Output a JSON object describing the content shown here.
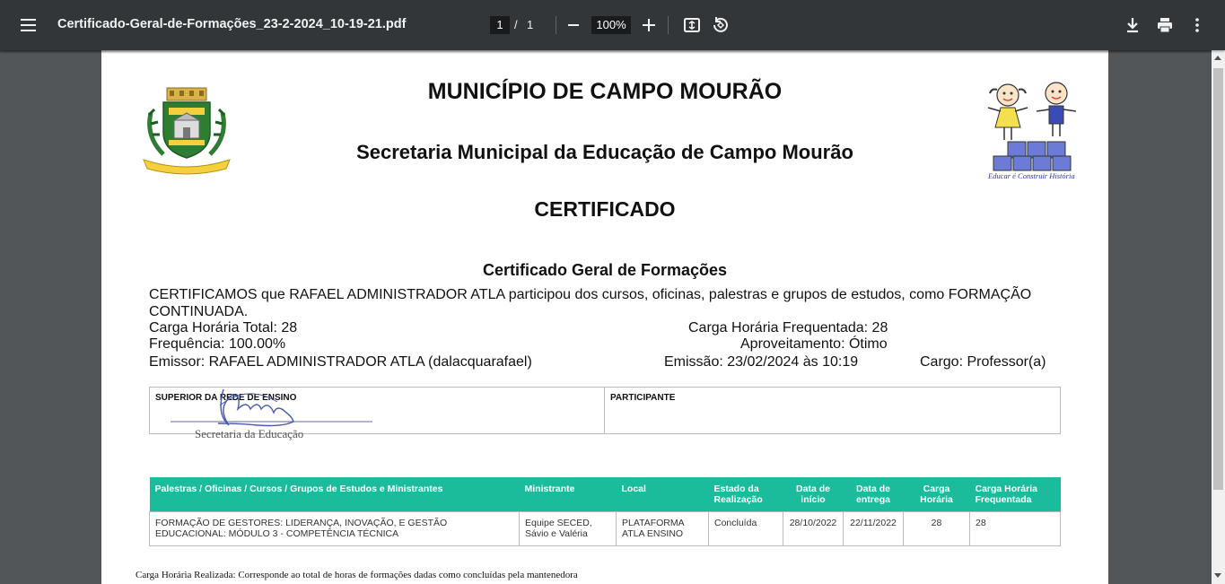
{
  "toolbar": {
    "file_title": "Certificado-Geral-de-Formações_23-2-2024_10-19-21.pdf",
    "current_page": "1",
    "page_separator": "/",
    "total_pages": "1",
    "zoom": "100%"
  },
  "document": {
    "header_title": "MUNICÍPIO DE CAMPO MOURÃO",
    "header_subtitle": "Secretaria Municipal da Educação de Campo Mourão",
    "certificate_title": "CERTIFICADO",
    "section_title": "Certificado Geral de Formações",
    "statement_line1": "CERTIFICAMOS que RAFAEL ADMINISTRADOR ATLA  participou dos cursos, oficinas, palestras e grupos de estudos, como FORMAÇÃO",
    "statement_line2": "CONTINUADA.",
    "carga_total": "Carga Horária Total: 28",
    "carga_frequentada": "Carga Horária Frequentada: 28",
    "frequencia": "Frequência: 100.00%",
    "aproveitamento": "Aproveitamento: Ótimo",
    "emissor": "Emissor: RAFAEL ADMINISTRADOR ATLA (dalacquarafael)",
    "emissao": "Emissão: 23/02/2024 às 10:19",
    "cargo": "Cargo: Professor(a)",
    "logo_text": "Educar é Construir História",
    "signature": {
      "superior_label": "SUPERIOR DA REDE DE ENSINO",
      "participante_label": "PARTICIPANTE",
      "signature_caption": "Secretaria da Educação"
    },
    "table": {
      "headers": [
        "Palestras / Oficinas / Cursos / Grupos de Estudos e Ministrantes",
        "Ministrante",
        "Local",
        "Estado da Realização",
        "Data de início",
        "Data de entrega",
        "Carga Horária",
        "Carga Horária Frequentada"
      ],
      "rows": [
        [
          "FORMAÇÃO DE GESTORES: LIDERANÇA, INOVAÇÃO, E GESTÃO EDUCACIONAL: MÓDULO 3 - COMPETÊNCIA TÉCNICA",
          "Equipe SECED, Sávio e Valéria",
          "PLATAFORMA ATLA ENSINO",
          "Concluída",
          "28/10/2022",
          "22/11/2022",
          "28",
          "28"
        ]
      ]
    },
    "footnote": "Carga Horária Realizada: Corresponde ao total de horas de formações dadas como concluídas pela mantenedora"
  },
  "colors": {
    "toolbar_bg": "#323639",
    "viewer_bg": "#525659",
    "table_header": "#1abc9c"
  }
}
